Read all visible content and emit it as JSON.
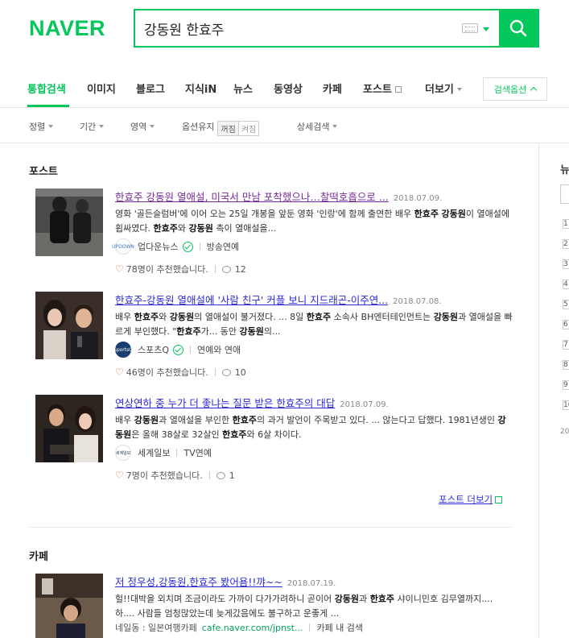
{
  "header": {
    "logo": "NAVER",
    "query": "강동원 한효주"
  },
  "nav": {
    "tabs": [
      "통합검색",
      "이미지",
      "블로그",
      "지식iN",
      "뉴스",
      "동영상",
      "카페",
      "포스트",
      "더보기"
    ],
    "options_label": "검색옵션"
  },
  "filters": {
    "sort": "정렬",
    "period": "기간",
    "area": "영역",
    "keep": "옵션유지",
    "toggle_on": "꺼짐",
    "toggle_off": "켜짐",
    "detail": "상세검색"
  },
  "sidebar": {
    "title": "뉴",
    "ranks": [
      "1",
      "2",
      "3",
      "4",
      "5",
      "6",
      "7",
      "8",
      "9",
      "10"
    ],
    "year": "20"
  },
  "post": {
    "title": "포스트",
    "more": "포스트 더보기",
    "items": [
      {
        "title": "한효주 강동원 열애설, 미국서 만남 포착했으나…찰떡호흡으로 ...",
        "date": "2018.07.09.",
        "desc_html": "영화 '골든슬럼버'에 이어 오는 25일 개봉을 앞둔 영화 '인랑'에 함께 출연한 배우 <b>한효주</b> <b>강동원</b>이 열애설에 휩싸였다. <b>한효주</b>와 <b>강동원</b> 측이 열애설을...",
        "source": "업다운뉴스",
        "source_logo": "UPDOWN",
        "category": "방송연예",
        "likes": "78명이 추천했습니다.",
        "comments": "12"
      },
      {
        "title": "한효주-강동원 열애설에 '사람 친구' 커플 보니 지드래곤-이주연...",
        "date": "2018.07.08.",
        "desc_html": "배우 <b>한효주</b>와 <b>강동원</b>의 열애설이 불거졌다. ... 8일 <b>한효주</b> 소속사 BH엔터테인먼트는 <b>강동원</b>과 열애설을 빠르게 부인했다. \"<b>한효주</b>가... 동안 <b>강동원</b>의...",
        "source": "스포츠Q",
        "source_logo": "SportsQ",
        "category": "연예와 연애",
        "likes": "46명이 추천했습니다.",
        "comments": "10"
      },
      {
        "title": "연상연하 중 누가 더 좋냐는 질문 받은 한효주의 대답",
        "date": "2018.07.09.",
        "desc_html": "배우 <b>강동원</b>과 열애설을 부인한 <b>한효주</b>의 과거 발언이 주목받고 있다. ... 않는다고 답했다. 1981년생인 <b>강동원</b>은 올해 38살로 32살인 <b>한효주</b>와 6살 차이다.",
        "source": "세계일보",
        "source_logo": "세계일보",
        "category": "TV연예",
        "likes": "7명이 추천했습니다.",
        "comments": "1"
      }
    ]
  },
  "cafe": {
    "title": "카페",
    "items": [
      {
        "title": "저 정우성,강동원,한효주 봤어욤!!꺄~~",
        "date": "2018.07.19.",
        "desc_html": "헐!!대박을 외치며 조금이라도 가까이 다가가려하니 곧이어 <b>강동원</b>과 <b>한효주</b> 샤이니민호 김무열까지.... 하.... 사람들 엄청많았는데 늦게갔음에도 불구하고 운좋게 ...",
        "source": "네일동 : 일본여행카페",
        "url": "cafe.naver.com/jpnst...",
        "search_in": "카페 내 검색"
      }
    ]
  },
  "colors": {
    "brand": "#03c75a",
    "link": "#2a2ad6",
    "visited": "#7a2a9a"
  }
}
